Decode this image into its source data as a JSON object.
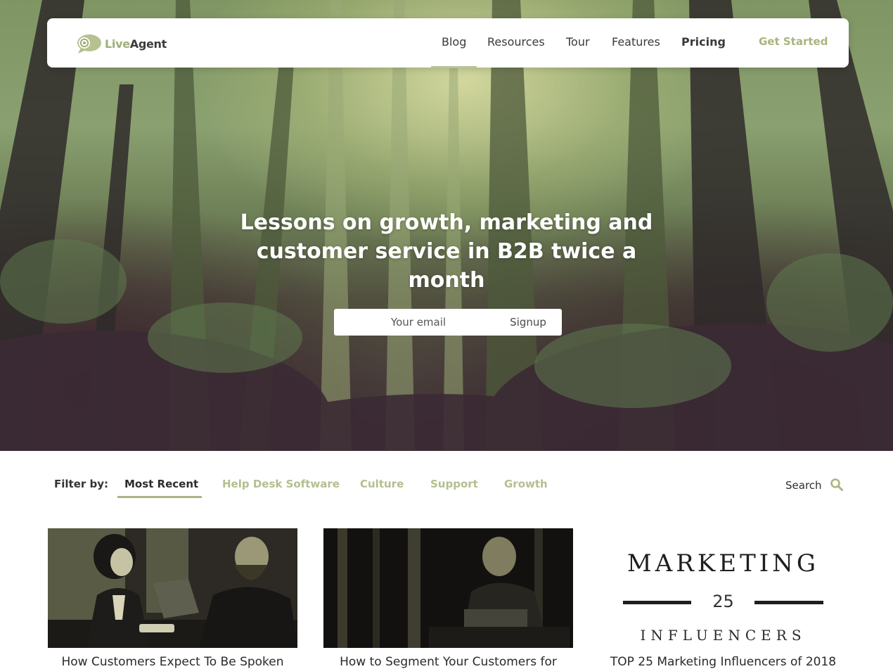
{
  "brand": {
    "name_live": "Live",
    "name_agent": "Agent",
    "accent": "#a8b57e"
  },
  "nav": {
    "items": [
      {
        "label": "Blog"
      },
      {
        "label": "Resources"
      },
      {
        "label": "Tour"
      },
      {
        "label": "Features"
      },
      {
        "label": "Pricing"
      }
    ],
    "cta": "Get Started"
  },
  "hero": {
    "title": "Lessons on growth, marketing and customer service in B2B twice a month",
    "email_placeholder": "Your email",
    "signup_label": "Signup"
  },
  "filter": {
    "label": "Filter by:",
    "tabs": [
      {
        "label": "Most Recent"
      },
      {
        "label": "Help Desk Software"
      },
      {
        "label": "Culture"
      },
      {
        "label": "Support"
      },
      {
        "label": "Growth"
      }
    ],
    "search_label": "Search"
  },
  "cards": [
    {
      "title": "How Customers Expect To Be Spoken"
    },
    {
      "title": "How to Segment Your Customers for"
    },
    {
      "title": "TOP 25 Marketing Influencers of 2018",
      "image_text": {
        "top": "MARKETING",
        "number": "25",
        "bottom": "INFLUENCERS"
      }
    }
  ]
}
